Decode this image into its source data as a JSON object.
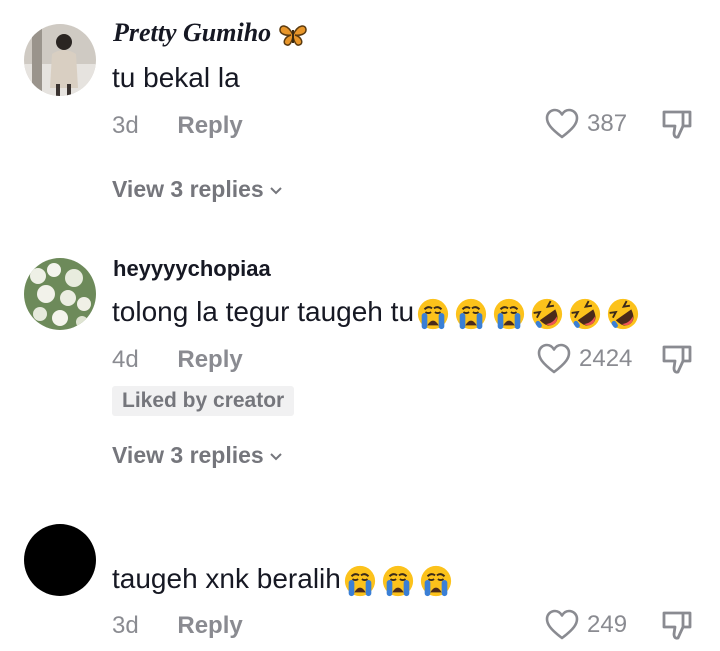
{
  "comments": [
    {
      "username": "Pretty Gumiho",
      "username_emoji": "butterfly-icon",
      "text": "tu bekal la",
      "age": "3d",
      "reply_label": "Reply",
      "likes": "387",
      "view_replies": "View 3 replies",
      "emojis": []
    },
    {
      "username": "heyyyychopiaa",
      "text": "tolong la tegur taugeh tu",
      "emojis": [
        "loudly-crying-face",
        "loudly-crying-face",
        "loudly-crying-face",
        "rolling-on-floor-laughing-face",
        "rolling-on-floor-laughing-face",
        "rolling-on-floor-laughing-face"
      ],
      "age": "4d",
      "reply_label": "Reply",
      "likes": "2424",
      "liked_by_creator": "Liked by creator",
      "view_replies": "View 3 replies"
    },
    {
      "username": "",
      "text": "taugeh xnk beralih",
      "emojis": [
        "loudly-crying-face",
        "loudly-crying-face",
        "loudly-crying-face"
      ],
      "age": "3d",
      "reply_label": "Reply",
      "likes": "249"
    }
  ],
  "colors": {
    "text": "#161823",
    "secondary": "#8a8b91",
    "badge_bg": "#f1f1f2"
  }
}
